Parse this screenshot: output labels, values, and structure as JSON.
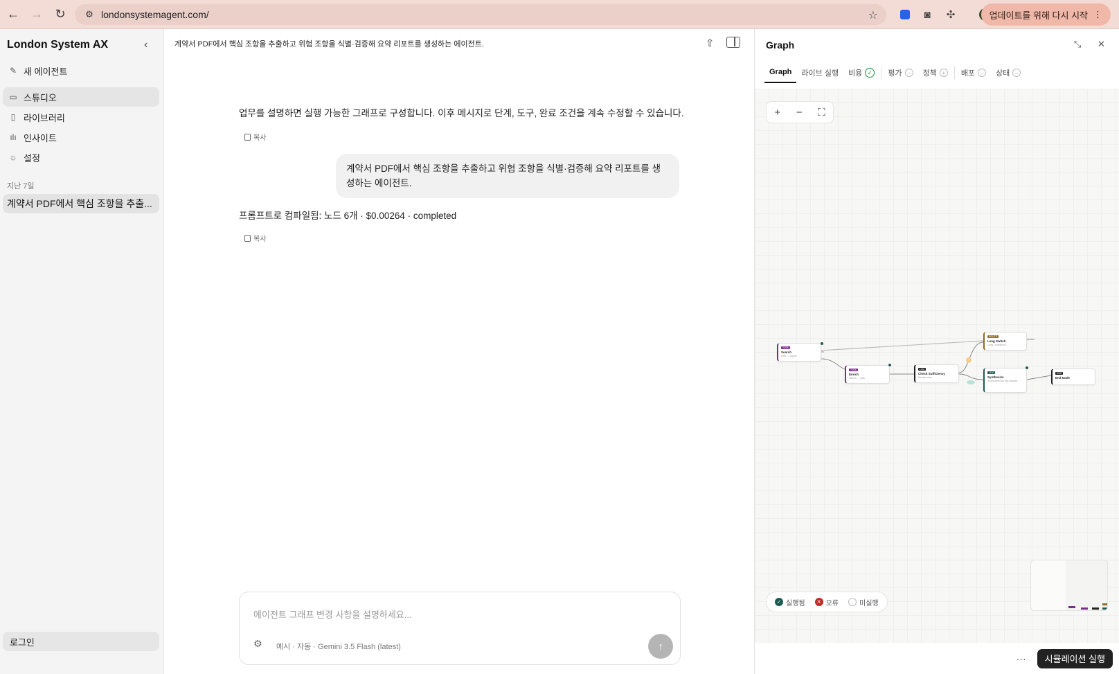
{
  "browser": {
    "url": "londonsystemagent.com/",
    "update_label": "업데이트를 위해 다시 시작"
  },
  "sidebar": {
    "brand": "London System AX",
    "new_agent": "새 에이전트",
    "items": [
      {
        "label": "스튜디오",
        "icon": "archive-icon",
        "active": true
      },
      {
        "label": "라이브러리",
        "icon": "book-icon",
        "active": false
      },
      {
        "label": "인사이트",
        "icon": "bar-chart-icon",
        "active": false
      },
      {
        "label": "설정",
        "icon": "gear-icon",
        "active": false
      }
    ],
    "section_label": "지난 7일",
    "history": [
      "계약서 PDF에서 핵심 조항을 추출..."
    ],
    "login": "로그인"
  },
  "chat": {
    "title": "계약서 PDF에서 핵심 조항을 추출하고 위험 조항을 식별·검증해 요약 리포트를 생성하는 에이전트.",
    "intro": "업무를 설명하면 실행 가능한 그래프로 구성합니다. 이후 메시지로 단계, 도구, 완료 조건을 계속 수정할 수 있습니다.",
    "copy_label": "복사",
    "user_message": "계약서 PDF에서 핵심 조항을 추출하고 위험 조항을 식별·검증해 요약 리포트를 생성하는 에이전트.",
    "compile_result": "프롬프트로 컴파일됨: 노드 6개 · $0.00264 · completed",
    "composer_placeholder": "에이전트 그래프 변경 사항을 설명하세요...",
    "composer_model": "예시 · 자동 · Gemini 3.5 Flash (latest)"
  },
  "panel": {
    "title": "Graph",
    "tabs": [
      {
        "label": "Graph",
        "status": "active"
      },
      {
        "label": "라이브 실행",
        "status": "none"
      },
      {
        "label": "비용",
        "status": "ok"
      },
      {
        "label": "평가",
        "status": "pending"
      },
      {
        "label": "정책",
        "status": "pending"
      },
      {
        "label": "배포",
        "status": "pending"
      },
      {
        "label": "상태",
        "status": "pending"
      }
    ],
    "nodes": [
      {
        "tag": "TOOL",
        "name": "Search",
        "sub": "tools · 1 inputs",
        "color": "#7b2d8e"
      },
      {
        "tag": "TOOL",
        "name": "Enrich",
        "sub": "Search → task",
        "color": "#7b2d8e"
      },
      {
        "tag": "LLM",
        "name": "Check Sufficiency",
        "sub": "Decide when",
        "color": "#222222"
      },
      {
        "tag": "ROUTE",
        "name": "Lang Switch",
        "sub": "Lang · conditions",
        "color": "#8a6d1e"
      },
      {
        "tag": "LLM",
        "name": "Synthesize",
        "sub": "Summarize key risk clauses",
        "color": "#1e5a52"
      },
      {
        "tag": "END",
        "name": "End Node",
        "sub": "",
        "color": "#222222"
      }
    ],
    "legend": [
      "실행됨",
      "오류",
      "미실행"
    ],
    "more_label": "···",
    "run_label": "시뮬레이션 실행"
  }
}
